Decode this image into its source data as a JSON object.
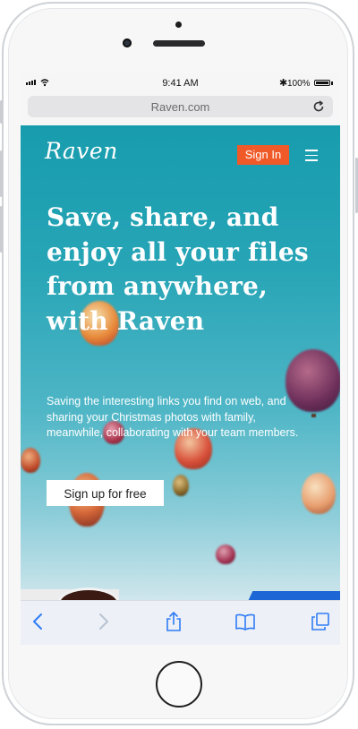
{
  "status_bar": {
    "time": "9:41 AM",
    "bluetooth": "✱",
    "battery": "100%"
  },
  "browser": {
    "url": "Raven.com"
  },
  "site": {
    "logo": "Raven",
    "sign_in": "Sign In",
    "headline": "Save, share, and enjoy all your files from anywhere, with Raven",
    "description": "Saving the interesting links you find on web, and sharing your Christmas photos with family, meanwhile, collaborating with your team members.",
    "cta": "Sign up for free"
  },
  "colors": {
    "accent": "#f05a28",
    "hero_top": "#179cae",
    "ios_blue": "#2f7cf6"
  },
  "icons": [
    "signal-icon",
    "wifi-icon",
    "bluetooth-icon",
    "battery-icon",
    "reload-icon",
    "menu-icon",
    "back-icon",
    "forward-icon",
    "share-icon",
    "bookmarks-icon",
    "tabs-icon"
  ]
}
